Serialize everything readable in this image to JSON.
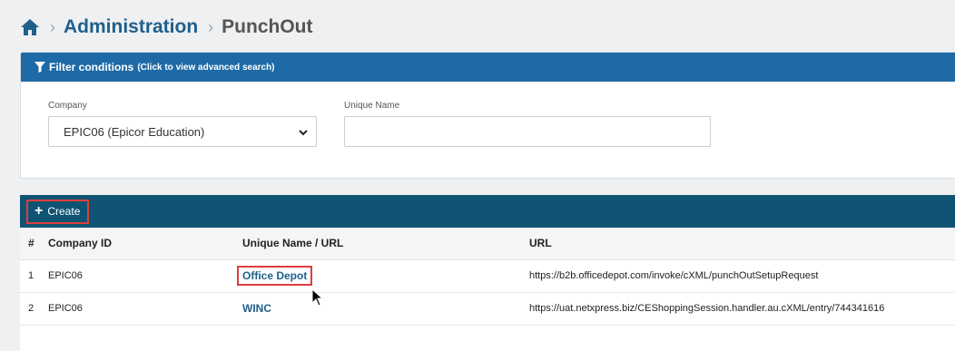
{
  "breadcrumb": {
    "home_icon": "home-icon",
    "items": [
      "Administration",
      "PunchOut"
    ]
  },
  "filter": {
    "title": "Filter conditions",
    "hint": "(Click to view advanced search)",
    "company_label": "Company",
    "company_value": "EPIC06 (Epicor Education)",
    "unique_name_label": "Unique Name",
    "unique_name_value": ""
  },
  "toolbar": {
    "create_label": "Create"
  },
  "table": {
    "columns": [
      "#",
      "Company ID",
      "Unique Name / URL",
      "URL"
    ],
    "rows": [
      {
        "num": "1",
        "company_id": "EPIC06",
        "unique_name": "Office Depot",
        "url": "https://b2b.officedepot.com/invoke/cXML/punchOutSetupRequest"
      },
      {
        "num": "2",
        "company_id": "EPIC06",
        "unique_name": "WINC",
        "url": "https://uat.netxpress.biz/CEShoppingSession.handler.au.cXML/entry/744341616"
      }
    ]
  },
  "colors": {
    "brand_blue": "#1d6aa6",
    "toolbar_teal": "#0f5372",
    "link_blue": "#1f5f8b",
    "highlight_red": "#e03c3c"
  }
}
